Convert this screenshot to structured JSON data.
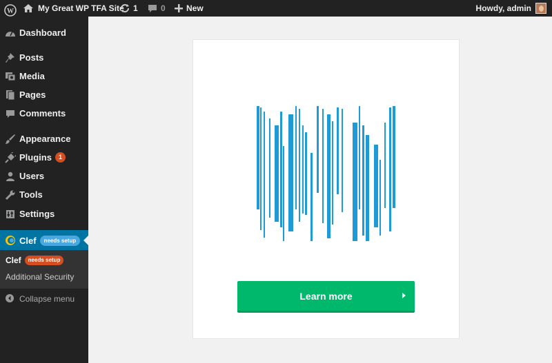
{
  "adminbar": {
    "site_name": "My Great WP TFA Site",
    "updates_count": "1",
    "comments_count": "0",
    "new_label": "New",
    "howdy": "Howdy, admin"
  },
  "sidebar": {
    "items": [
      {
        "key": "dashboard",
        "label": "Dashboard",
        "icon": "dashboard-icon"
      },
      {
        "key": "posts",
        "label": "Posts",
        "icon": "pin-icon"
      },
      {
        "key": "media",
        "label": "Media",
        "icon": "media-icon"
      },
      {
        "key": "pages",
        "label": "Pages",
        "icon": "pages-icon"
      },
      {
        "key": "comments",
        "label": "Comments",
        "icon": "comment-icon"
      },
      {
        "key": "appearance",
        "label": "Appearance",
        "icon": "brush-icon"
      },
      {
        "key": "plugins",
        "label": "Plugins",
        "icon": "plug-icon",
        "badge": "1"
      },
      {
        "key": "users",
        "label": "Users",
        "icon": "user-icon"
      },
      {
        "key": "tools",
        "label": "Tools",
        "icon": "wrench-icon"
      },
      {
        "key": "settings",
        "label": "Settings",
        "icon": "settings-icon"
      }
    ],
    "clef": {
      "label": "Clef",
      "badge": "needs setup"
    },
    "submenu": {
      "current_label": "Clef",
      "current_badge": "needs setup",
      "additional_security": "Additional Security"
    },
    "collapse_label": "Collapse menu"
  },
  "main": {
    "learn_more_label": "Learn more"
  },
  "colors": {
    "admin_bar": "#222222",
    "active_menu": "#0074a2",
    "badge_orange": "#d54e21",
    "barcode_blue": "#1e9ad6",
    "button_green": "#00b86b"
  }
}
